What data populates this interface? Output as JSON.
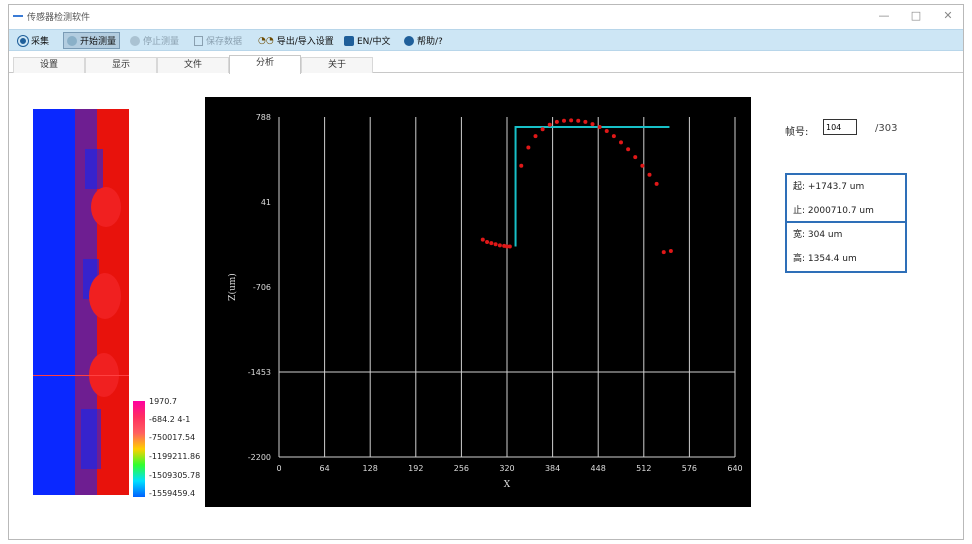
{
  "window": {
    "title": "传感器检测软件"
  },
  "toolbar": {
    "items": [
      {
        "label": "采集",
        "icon": "gear-icon"
      },
      {
        "label": "开始测量",
        "icon": "play-icon"
      },
      {
        "label": "停止测量",
        "icon": "stop-icon"
      },
      {
        "label": "保存数据",
        "icon": "save-icon"
      },
      {
        "label": "导出/导入设置",
        "icon": "glasses-icon"
      },
      {
        "label": "EN/中文",
        "icon": "language-icon"
      },
      {
        "label": "帮助/?",
        "icon": "help-icon"
      }
    ]
  },
  "tabs": [
    "设置",
    "显示",
    "文件",
    "分析",
    "关于"
  ],
  "active_tab": "分析",
  "colorbar": {
    "labels": [
      "1970.7",
      "-684.2 4-1",
      "-750017.54",
      "-1199211.86",
      "-1509305.78",
      "-1559459.4"
    ]
  },
  "info": {
    "frame_label": "帧号:",
    "frame_value": "104",
    "frame_total": "/303",
    "box1": [
      "起: +1743.7 um",
      "止: 2000710.7 um"
    ],
    "box2": [
      "宽: 304 um",
      "高: 1354.4 um"
    ]
  },
  "colors": {
    "plot_bg": "#000000",
    "profile": "#e01818",
    "measure": "#17c0c8",
    "grid": "#cfcfcf"
  },
  "chart_data": {
    "type": "scatter",
    "title": "",
    "xlabel": "X",
    "ylabel": "Z(um)",
    "xlim": [
      0,
      640
    ],
    "ylim": [
      -2200,
      788
    ],
    "y_reversed": true,
    "x_ticks": [
      "0",
      "64",
      "128",
      "192",
      "256",
      "320",
      "384",
      "448",
      "512",
      "576",
      "640"
    ],
    "y_ticks": [
      "788",
      "41",
      "-706",
      "-1453",
      "-2200"
    ],
    "grid": "x-lines",
    "series": [
      {
        "x": [
          286,
          292,
          298,
          304,
          310,
          316,
          320,
          324,
          340,
          350,
          360,
          370,
          380,
          390,
          400,
          410,
          420,
          430,
          440,
          450,
          460,
          470,
          480,
          490,
          500,
          510,
          520,
          530,
          540,
          550
        ],
        "y": [
          -290,
          -310,
          -320,
          -330,
          -340,
          -345,
          -350,
          -350,
          360,
          520,
          620,
          680,
          720,
          745,
          755,
          758,
          755,
          745,
          725,
          700,
          665,
          620,
          565,
          505,
          435,
          360,
          280,
          200,
          -400,
          -390
        ]
      },
      {
        "x": [
          332,
          332,
          548
        ],
        "y": [
          -350,
          700,
          700
        ]
      }
    ]
  }
}
